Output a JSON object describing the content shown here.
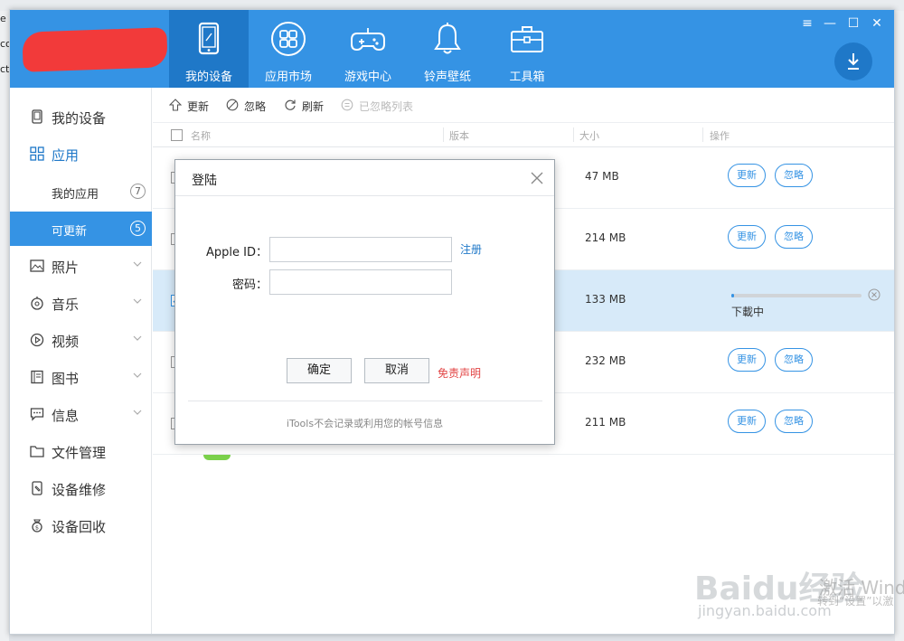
{
  "background_fragments": [
    "e",
    "co",
    "ct"
  ],
  "nav": {
    "tabs": [
      {
        "label": "我的设备",
        "icon": "tablet-icon",
        "active": true
      },
      {
        "label": "应用市场",
        "icon": "apps-grid-icon",
        "active": false
      },
      {
        "label": "游戏中心",
        "icon": "gamepad-icon",
        "active": false
      },
      {
        "label": "铃声壁纸",
        "icon": "bell-icon",
        "active": false
      },
      {
        "label": "工具箱",
        "icon": "toolbox-icon",
        "active": false
      }
    ],
    "accent_color": "#3593e4",
    "active_color": "#1f78c8"
  },
  "window_controls": {
    "menu": "≡",
    "minimize": "—",
    "maximize": "☐",
    "close": "✕"
  },
  "sidebar": {
    "items": [
      {
        "label": "我的设备",
        "icon": "phone-icon"
      },
      {
        "label": "应用",
        "icon": "apps-icon"
      },
      {
        "label": "我的应用",
        "count": "7"
      },
      {
        "label": "可更新",
        "count": "5"
      },
      {
        "label": "照片",
        "icon": "photo-icon"
      },
      {
        "label": "音乐",
        "icon": "music-icon"
      },
      {
        "label": "视频",
        "icon": "video-icon"
      },
      {
        "label": "图书",
        "icon": "book-icon"
      },
      {
        "label": "信息",
        "icon": "message-icon"
      },
      {
        "label": "文件管理",
        "icon": "folder-icon"
      },
      {
        "label": "设备维修",
        "icon": "repair-icon"
      },
      {
        "label": "设备回收",
        "icon": "recycle-icon"
      }
    ]
  },
  "toolbar": {
    "update": "更新",
    "ignore": "忽略",
    "refresh": "刷新",
    "ignored_list": "已忽略列表"
  },
  "table": {
    "headers": {
      "name": "名称",
      "version": "版本",
      "size": "大小",
      "action": "操作"
    },
    "rows": [
      {
        "size": "47 MB",
        "status": "buttons",
        "update": "更新",
        "ignore": "忽略"
      },
      {
        "size": "214 MB",
        "status": "buttons",
        "update": "更新",
        "ignore": "忽略"
      },
      {
        "size": "133 MB",
        "status": "downloading",
        "progress": 0.02,
        "status_text": "下載中"
      },
      {
        "size": "232 MB",
        "status": "buttons",
        "update": "更新",
        "ignore": "忽略"
      },
      {
        "size": "211 MB",
        "status": "buttons",
        "update": "更新",
        "ignore": "忽略"
      }
    ]
  },
  "login_dialog": {
    "title": "登陆",
    "apple_id_label": "Apple ID：",
    "password_label": "密码：",
    "apple_id_value": "",
    "password_value": "",
    "register_link": "注册",
    "confirm": "确定",
    "cancel": "取消",
    "disclaimer": "免责声明",
    "footer": "iTools不会记录或利用您的帐号信息"
  },
  "watermark": {
    "logo": "Baidu经验",
    "url": "jingyan.baidu.com",
    "windows_line1": "激活 Windo",
    "windows_line2": "转到“设置”以激"
  }
}
